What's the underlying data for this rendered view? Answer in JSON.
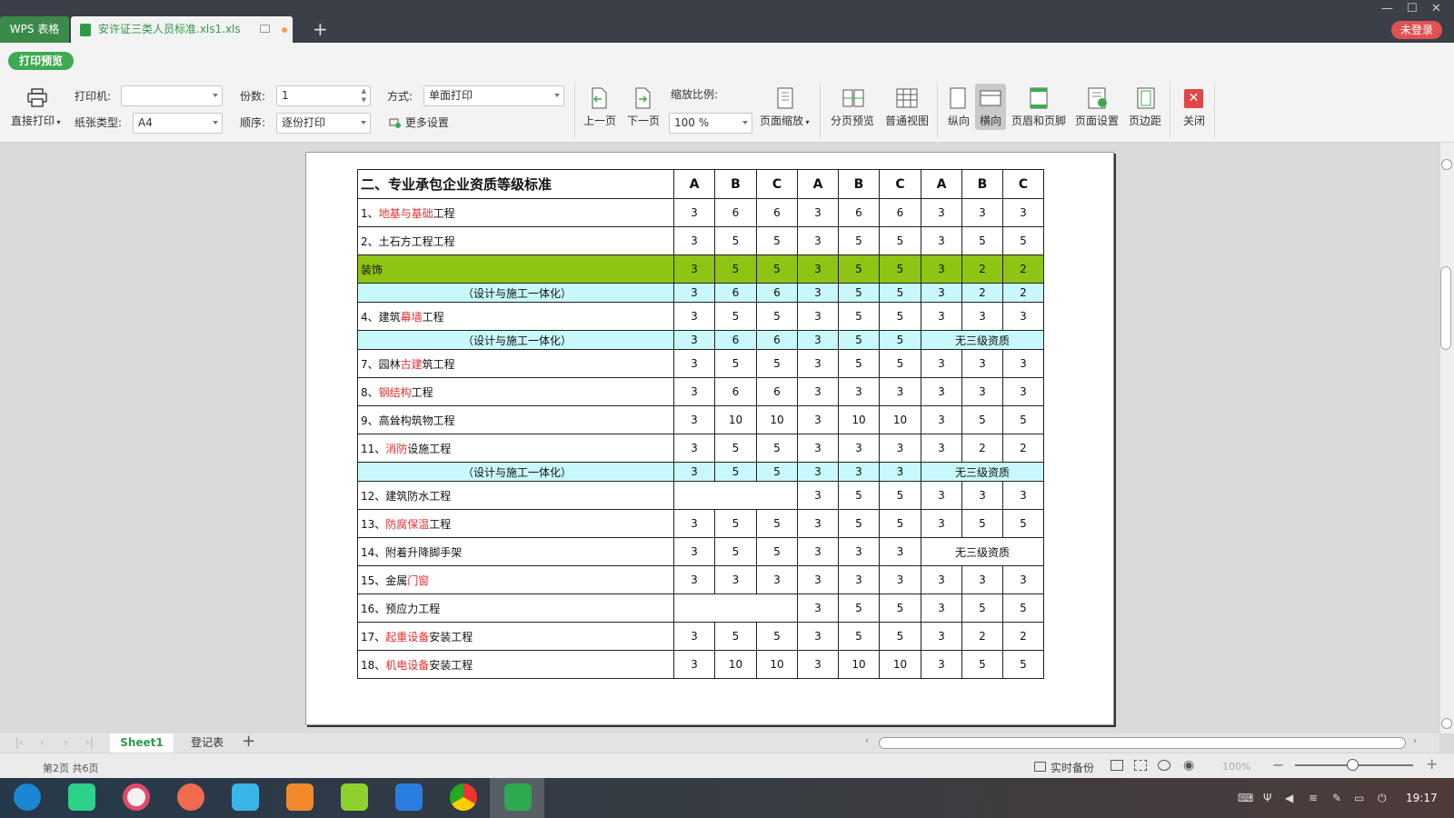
{
  "titlebar": {
    "app_tab": "WPS 表格",
    "doc_tab": "安许证三类人员标准.xls1.xls",
    "login": "未登录",
    "new_tab": "+"
  },
  "print_preview_label": "打印预览",
  "toolbar": {
    "direct_print": "直接打印",
    "printer_label": "打印机:",
    "printer_value": "",
    "paper_label": "纸张类型:",
    "paper_value": "A4",
    "copies_label": "份数:",
    "copies_value": "1",
    "order_label": "顺序:",
    "order_value": "逐份打印",
    "mode_label": "方式:",
    "mode_value": "单面打印",
    "more_settings": "更多设置",
    "prev_page": "上一页",
    "next_page": "下一页",
    "scale_label": "缩放比例:",
    "scale_value": "100 %",
    "page_scale": "页面缩放",
    "page_break_preview": "分页预览",
    "normal_view": "普通视图",
    "portrait": "纵向",
    "landscape": "横向",
    "header_footer": "页眉和页脚",
    "page_setup": "页面设置",
    "margins": "页边距",
    "close": "关闭"
  },
  "sheet": {
    "title": "二、专业承包企业资质等级标准",
    "columns": [
      "A",
      "B",
      "C",
      "A",
      "B",
      "C",
      "A",
      "B",
      "C"
    ],
    "rows": [
      {
        "style": "normal",
        "h": 31,
        "name": [
          {
            "t": "1、"
          },
          {
            "t": "地基与基础",
            "red": true
          },
          {
            "t": "工程"
          }
        ],
        "cells": [
          "3",
          "6",
          "6",
          "3",
          "6",
          "6",
          "3",
          "3",
          "3"
        ]
      },
      {
        "style": "normal",
        "h": 31,
        "name": [
          {
            "t": "2、土石方工程工程"
          }
        ],
        "cells": [
          "3",
          "5",
          "5",
          "3",
          "5",
          "5",
          "3",
          "5",
          "5"
        ]
      },
      {
        "style": "green",
        "h": 31,
        "name": [
          {
            "t": "装饰"
          }
        ],
        "cells": [
          "3",
          "5",
          "5",
          "3",
          "5",
          "5",
          "3",
          "2",
          "2"
        ]
      },
      {
        "style": "cyan",
        "h": 21,
        "center": true,
        "name": [
          {
            "t": "（设计与施工一体化）"
          }
        ],
        "cells": [
          "3",
          "6",
          "6",
          "3",
          "5",
          "5",
          "3",
          "2",
          "2"
        ]
      },
      {
        "style": "normal",
        "h": 31,
        "name": [
          {
            "t": "4、建筑"
          },
          {
            "t": "幕墙",
            "red": true
          },
          {
            "t": "工程"
          }
        ],
        "cells": [
          "3",
          "5",
          "5",
          "3",
          "5",
          "5",
          "3",
          "3",
          "3"
        ]
      },
      {
        "style": "cyan",
        "h": 21,
        "center": true,
        "name": [
          {
            "t": "（设计与施工一体化）"
          }
        ],
        "cells": [
          "3",
          "6",
          "6",
          "3",
          "5",
          "5"
        ],
        "merged_last": "无三级资质"
      },
      {
        "style": "normal",
        "h": 31,
        "name": [
          {
            "t": "7、园林"
          },
          {
            "t": "古建",
            "red": true
          },
          {
            "t": "筑工程"
          }
        ],
        "cells": [
          "3",
          "5",
          "5",
          "3",
          "5",
          "5",
          "3",
          "3",
          "3"
        ]
      },
      {
        "style": "normal",
        "h": 31,
        "name": [
          {
            "t": "8、"
          },
          {
            "t": "钢结构",
            "red": true
          },
          {
            "t": "工程"
          }
        ],
        "cells": [
          "3",
          "6",
          "6",
          "3",
          "3",
          "3",
          "3",
          "3",
          "3"
        ]
      },
      {
        "style": "normal",
        "h": 31,
        "name": [
          {
            "t": "9、高耸构筑物工程"
          }
        ],
        "cells": [
          "3",
          "10",
          "10",
          "3",
          "10",
          "10",
          "3",
          "5",
          "5"
        ]
      },
      {
        "style": "normal",
        "h": 31,
        "name": [
          {
            "t": "11、"
          },
          {
            "t": "消防",
            "red": true
          },
          {
            "t": "设施工程"
          }
        ],
        "cells": [
          "3",
          "5",
          "5",
          "3",
          "3",
          "3",
          "3",
          "2",
          "2"
        ]
      },
      {
        "style": "cyan",
        "h": 21,
        "center": true,
        "name": [
          {
            "t": "（设计与施工一体化）"
          }
        ],
        "cells": [
          "3",
          "5",
          "5",
          "3",
          "3",
          "3"
        ],
        "merged_last": "无三级资质"
      },
      {
        "style": "normal",
        "h": 31,
        "name": [
          {
            "t": "12、建筑防水工程"
          }
        ],
        "merged_first": "",
        "cells": [
          "3",
          "5",
          "5",
          "3",
          "3",
          "3"
        ]
      },
      {
        "style": "normal",
        "h": 31,
        "name": [
          {
            "t": "13、"
          },
          {
            "t": "防腐保温",
            "red": true
          },
          {
            "t": "工程"
          }
        ],
        "cells": [
          "3",
          "5",
          "5",
          "3",
          "5",
          "5",
          "3",
          "5",
          "5"
        ]
      },
      {
        "style": "normal",
        "h": 31,
        "name": [
          {
            "t": "14、附着升降脚手架"
          }
        ],
        "cells": [
          "3",
          "5",
          "5",
          "3",
          "3",
          "3"
        ],
        "merged_last": "无三级资质"
      },
      {
        "style": "normal",
        "h": 31,
        "name": [
          {
            "t": "15、金属"
          },
          {
            "t": "门窗",
            "red": true
          }
        ],
        "cells": [
          "3",
          "3",
          "3",
          "3",
          "3",
          "3",
          "3",
          "3",
          "3"
        ]
      },
      {
        "style": "normal",
        "h": 31,
        "name": [
          {
            "t": "16、预应力工程"
          }
        ],
        "merged_first": "",
        "cells": [
          "3",
          "5",
          "5",
          "3",
          "5",
          "5"
        ]
      },
      {
        "style": "normal",
        "h": 31,
        "name": [
          {
            "t": "17、"
          },
          {
            "t": "起重设备",
            "red": true
          },
          {
            "t": "安装工程"
          }
        ],
        "cells": [
          "3",
          "5",
          "5",
          "3",
          "5",
          "5",
          "3",
          "2",
          "2"
        ]
      },
      {
        "style": "normal",
        "h": 31,
        "name": [
          {
            "t": "18、"
          },
          {
            "t": "机电设备",
            "red": true
          },
          {
            "t": "安装工程"
          }
        ],
        "cells": [
          "3",
          "10",
          "10",
          "3",
          "10",
          "10",
          "3",
          "5",
          "5"
        ]
      }
    ]
  },
  "tabs": {
    "sheet1": "Sheet1",
    "register": "登记表",
    "add": "+"
  },
  "status": {
    "page_info": "第2页 共6页",
    "backup": "实时备份",
    "zoom": "100%"
  },
  "taskbar": {
    "clock": "19:17"
  },
  "colors": {
    "green_row": "#8ec413",
    "cyan_row": "#c8f8fb",
    "red_text": "#e83030",
    "wps_green": "#2f9a48",
    "login_red": "#e05252"
  }
}
